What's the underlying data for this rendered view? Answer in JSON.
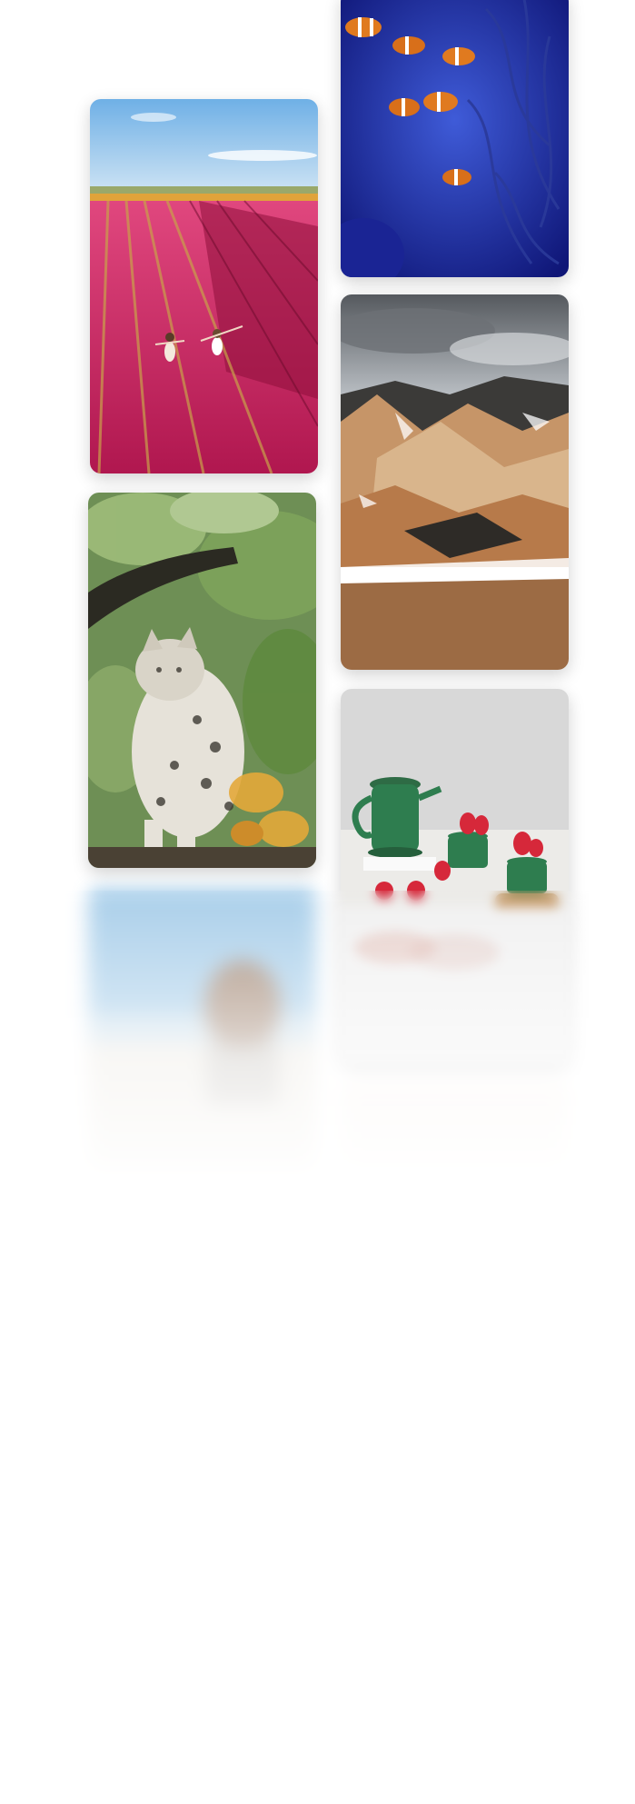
{
  "gallery": {
    "images": [
      {
        "subject": "tulip-field",
        "column": 1
      },
      {
        "subject": "snow-leopard",
        "column": 1
      },
      {
        "subject": "beach-person-blurred",
        "column": 1
      },
      {
        "subject": "clownfish-coral",
        "column": 2
      },
      {
        "subject": "rhyolite-mountains",
        "column": 2
      },
      {
        "subject": "green-teapot-strawberries",
        "column": 2
      },
      {
        "subject": "blurred-placeholder",
        "column": 2
      }
    ]
  },
  "colors": {
    "background": "#ffffff",
    "tulip_pink": "#c2185b",
    "sky_blue": "#8fc3ea",
    "ocean_blue": "#1e2aa8",
    "teapot_green": "#2e7d4f",
    "strawberry_red": "#d6283a"
  }
}
